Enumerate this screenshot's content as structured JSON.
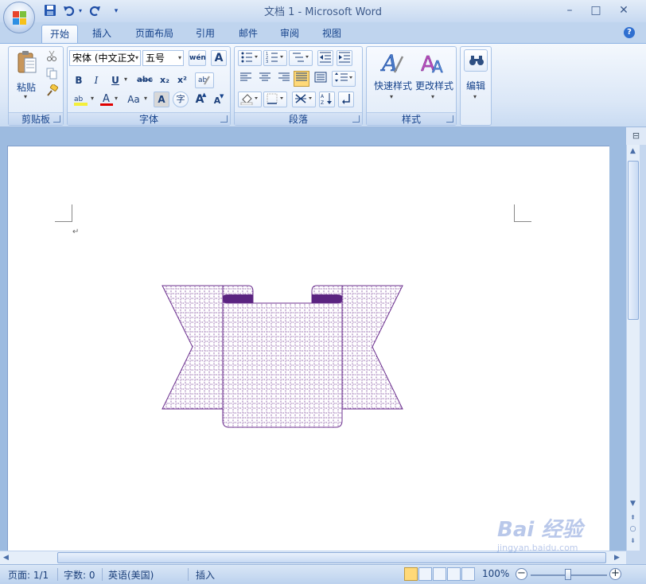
{
  "window": {
    "title": "文档 1 - Microsoft Word",
    "minimize": "–",
    "maximize": "□",
    "close": "✕"
  },
  "qat": {
    "save_icon": "save-icon",
    "undo_icon": "undo-icon",
    "redo_icon": "redo-icon",
    "customize_icon": "dropdown-icon"
  },
  "tabs": [
    "开始",
    "插入",
    "页面布局",
    "引用",
    "邮件",
    "审阅",
    "视图"
  ],
  "ribbon": {
    "clipboard": {
      "label": "剪贴板",
      "paste": "粘贴"
    },
    "font": {
      "label": "字体",
      "font_name": "宋体 (中文正文",
      "font_size": "五号",
      "bold": "B",
      "italic": "I",
      "underline": "U",
      "strike": "abc",
      "subscript": "x₂",
      "superscript": "x²",
      "case": "Aa",
      "grow": "A",
      "shrink": "A",
      "char_border": "A",
      "enclose": "字"
    },
    "paragraph": {
      "label": "段落"
    },
    "styles": {
      "label": "样式",
      "quick_styles": "快速样式",
      "change_styles": "更改样式"
    },
    "editing": {
      "label": "编辑"
    }
  },
  "document": {
    "paragraph_mark": "↵"
  },
  "status": {
    "page": "页面: 1/1",
    "words": "字数: 0",
    "language": "英语(美国)",
    "mode": "插入",
    "zoom": "100%",
    "zoom_minus": "−",
    "zoom_plus": "+"
  },
  "colors": {
    "shape_stroke": "#6b2f8e",
    "shape_fold": "#5a2480",
    "highlight": "#f4ef3a",
    "font_color": "#e00000"
  },
  "watermark": {
    "brand": "Bai 经验",
    "site": "jingyan.baidu.com"
  }
}
